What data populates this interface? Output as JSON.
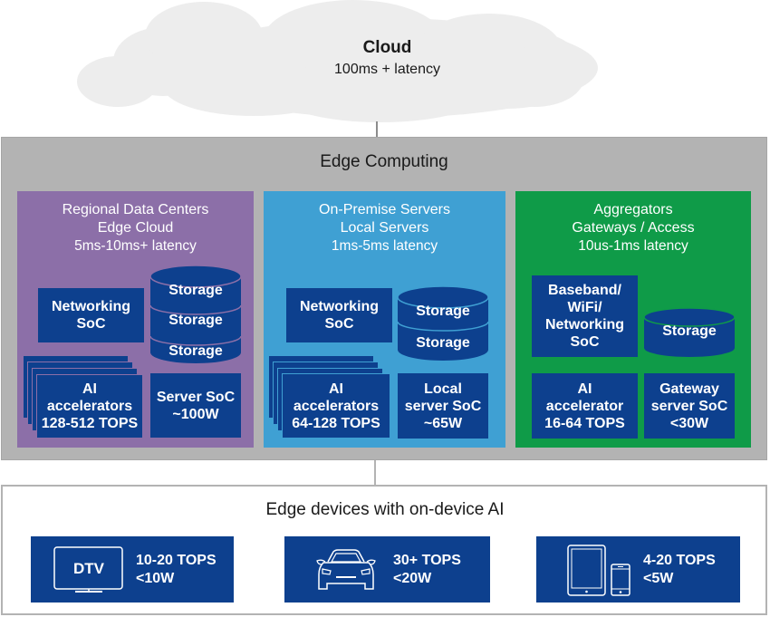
{
  "colors": {
    "cloud_fill": "#ededed",
    "edge_panel": "#b3b3b3",
    "regional_tier": "#8c6fa8",
    "onprem_tier": "#3fa0d3",
    "aggregator_tier": "#0f9b48",
    "block_navy": "#0d408e",
    "text_dark": "#1a1a1a",
    "text_light": "#ffffff"
  },
  "cloud": {
    "title": "Cloud",
    "latency": "100ms + latency",
    "icon": "cloud-icon"
  },
  "edge_computing": {
    "title": "Edge Computing",
    "tiers": [
      {
        "name": "regional",
        "heading": [
          "Regional Data Centers",
          "Edge Cloud",
          "5ms-10ms+ latency"
        ],
        "networking": [
          "Networking",
          "SoC"
        ],
        "storage": [
          "Storage",
          "Storage",
          "Storage"
        ],
        "accelerators": [
          "AI",
          "accelerators",
          "128-512 TOPS"
        ],
        "server": [
          "Server SoC",
          "~100W"
        ]
      },
      {
        "name": "on-premise",
        "heading": [
          "On-Premise Servers",
          "Local Servers",
          "1ms-5ms latency"
        ],
        "networking": [
          "Networking",
          "SoC"
        ],
        "storage": [
          "Storage",
          "Storage"
        ],
        "accelerators": [
          "AI",
          "accelerators",
          "64-128 TOPS"
        ],
        "server": [
          "Local",
          "server SoC",
          "~65W"
        ]
      },
      {
        "name": "aggregators",
        "heading": [
          "Aggregators",
          "Gateways / Access",
          "10us-1ms latency"
        ],
        "networking": [
          "Baseband/",
          "WiFi/",
          "Networking",
          "SoC"
        ],
        "storage": [
          "Storage"
        ],
        "accelerators": [
          "AI",
          "accelerator",
          "16-64 TOPS"
        ],
        "server": [
          "Gateway",
          "server SoC",
          "<30W"
        ]
      }
    ]
  },
  "edge_devices": {
    "title": "Edge devices with on-device AI",
    "devices": [
      {
        "icon": "tv-icon",
        "icon_label": "DTV",
        "tops": "10-20 TOPS",
        "power": "<10W"
      },
      {
        "icon": "car-icon",
        "tops": "30+ TOPS",
        "power": "<20W"
      },
      {
        "icon": "tablet-phone-icon",
        "tops": "4-20 TOPS",
        "power": "<5W"
      }
    ]
  }
}
